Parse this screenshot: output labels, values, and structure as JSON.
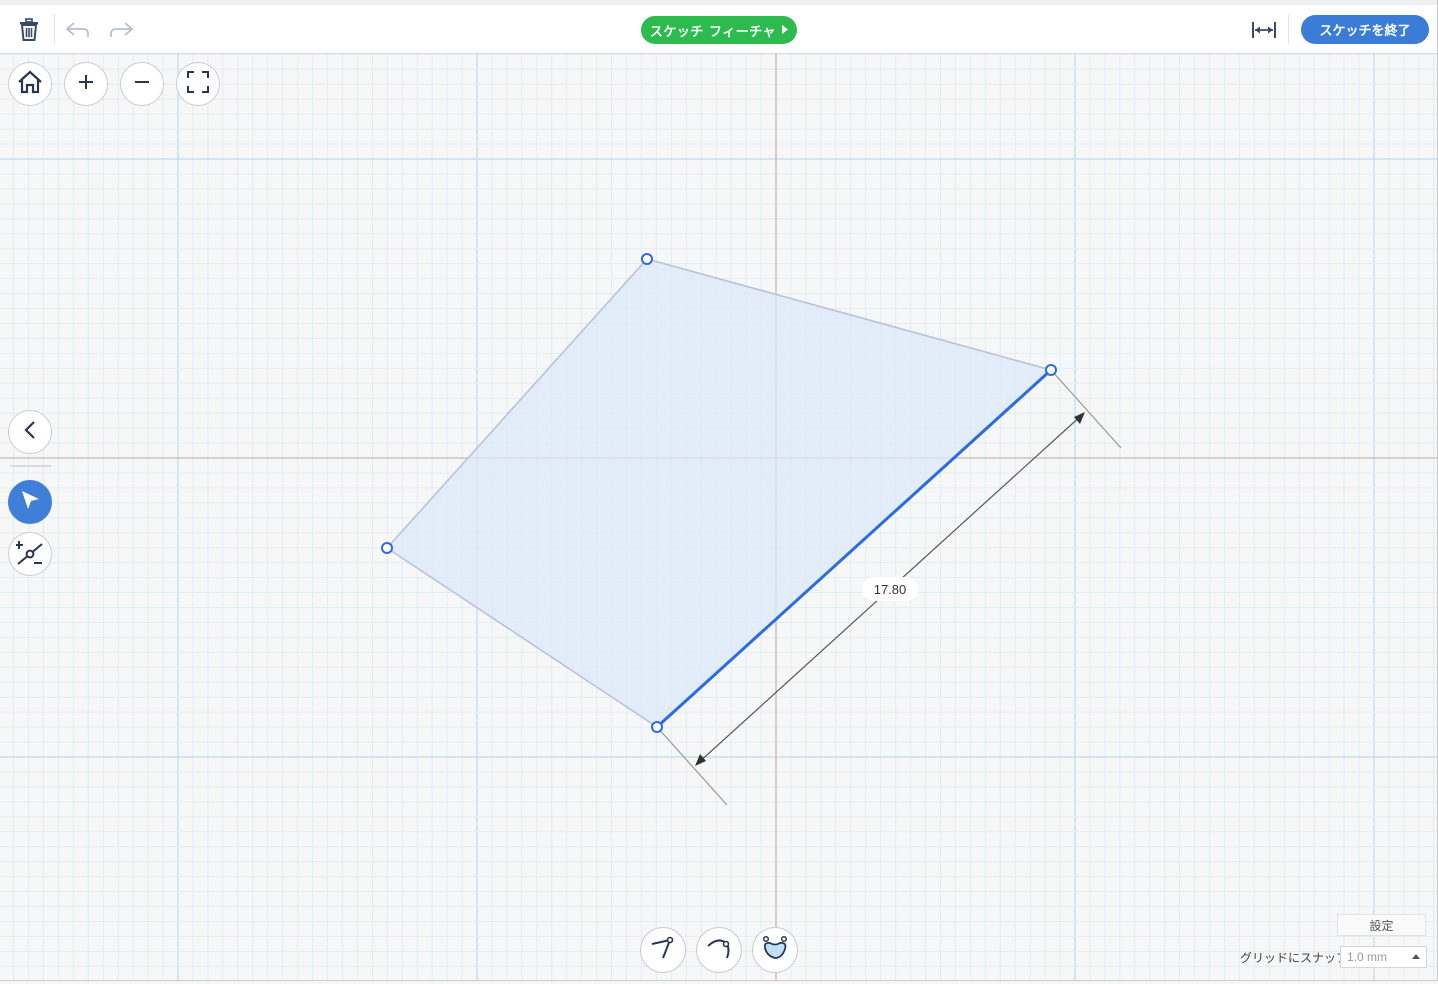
{
  "toolbar": {
    "delete_icon": "trash-icon",
    "undo_icon": "undo-icon",
    "redo_icon": "redo-icon",
    "feature_label": "スケッチ フィーチャ",
    "measure_icon": "dimension-icon",
    "finish_label": "スケッチを終了"
  },
  "view_controls": {
    "home_icon": "home-icon",
    "zoom_in_icon": "plus-icon",
    "zoom_out_icon": "minus-icon",
    "fit_icon": "fit-screen-icon"
  },
  "side_tools": {
    "collapse_icon": "chevron-left-icon",
    "select_icon": "pointer-icon",
    "point_icon": "add-remove-point-icon"
  },
  "sketch": {
    "dimension_value": "17.80",
    "colors": {
      "selected_edge": "#2a6be0",
      "fill": "#dce8fa",
      "edge": "#b8c3d8",
      "vertex": "#2a6be0"
    }
  },
  "bottom_tools": [
    "line-tool-icon",
    "arc-tool-icon",
    "spline-shape-icon"
  ],
  "settings": {
    "label": "設定",
    "snap_label": "グリッドにスナップ",
    "snap_value": "1.0 mm"
  }
}
